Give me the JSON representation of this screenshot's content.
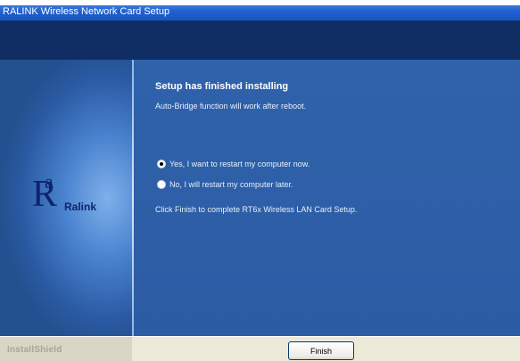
{
  "window": {
    "title": "RALINK Wireless Network Card Setup"
  },
  "logo": {
    "brand": "Ralink",
    "logo_letters": "Ra"
  },
  "main": {
    "heading": "Setup has finished installing",
    "subtext": "Auto-Bridge function will work after reboot.",
    "options": [
      {
        "label": "Yes, I want to restart my computer now.",
        "selected": true
      },
      {
        "label": "No, I will restart my computer later.",
        "selected": false
      }
    ],
    "finish_note": "Click Finish to complete RT6x Wireless LAN Card Setup."
  },
  "footer": {
    "installshield_label": "InstallShield",
    "finish_label": "Finish"
  },
  "colors": {
    "header_band": "#0f2d63",
    "content_bg": "#2d5ea6",
    "logo_dark": "#10236a"
  }
}
